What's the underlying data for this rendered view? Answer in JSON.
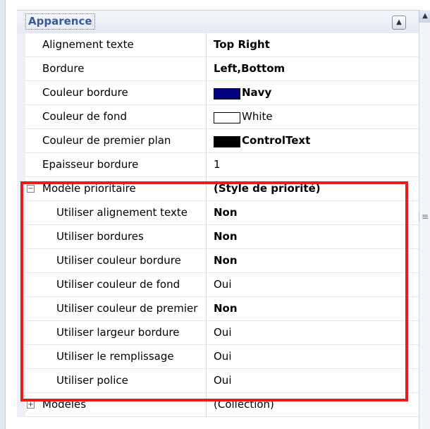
{
  "category": {
    "label": "Apparence",
    "collapse_icon": "chevron-up-icon"
  },
  "rows": [
    {
      "name": "Alignement texte",
      "value": "Top Right",
      "bold": true
    },
    {
      "name": "Bordure",
      "value": "Left,Bottom",
      "bold": true
    },
    {
      "name": "Couleur bordure",
      "value": "Navy",
      "bold": true,
      "swatch": "#000080"
    },
    {
      "name": "Couleur de fond",
      "value": "White",
      "bold": false,
      "swatch": "#ffffff"
    },
    {
      "name": "Couleur de premier plan",
      "value": "ControlText",
      "bold": true,
      "swatch": "#000000"
    },
    {
      "name": "Epaisseur bordure",
      "value": "1",
      "bold": false
    },
    {
      "name": "Modèle prioritaire",
      "value": "(Style de priorité)",
      "bold": true,
      "expander": "⊟"
    },
    {
      "name": "Utiliser alignement texte",
      "value": "Non",
      "bold": true,
      "indent": true
    },
    {
      "name": "Utiliser bordures",
      "value": "Non",
      "bold": true,
      "indent": true
    },
    {
      "name": "Utiliser couleur bordure",
      "value": "Non",
      "bold": true,
      "indent": true
    },
    {
      "name": "Utiliser couleur de fond",
      "value": "Oui",
      "bold": false,
      "indent": true
    },
    {
      "name": "Utiliser couleur de premier",
      "value": "Non",
      "bold": true,
      "indent": true
    },
    {
      "name": "Utiliser largeur bordure",
      "value": "Oui",
      "bold": false,
      "indent": true
    },
    {
      "name": "Utiliser le remplissage",
      "value": "Oui",
      "bold": false,
      "indent": true
    },
    {
      "name": "Utiliser police",
      "value": "Oui",
      "bold": false,
      "indent": true
    },
    {
      "name": "Modèles",
      "value": "(Collection)",
      "bold": false,
      "expander": "⊞"
    }
  ],
  "colors": {
    "highlight": "#e41d1d",
    "category_text": "#3a5a9a"
  }
}
